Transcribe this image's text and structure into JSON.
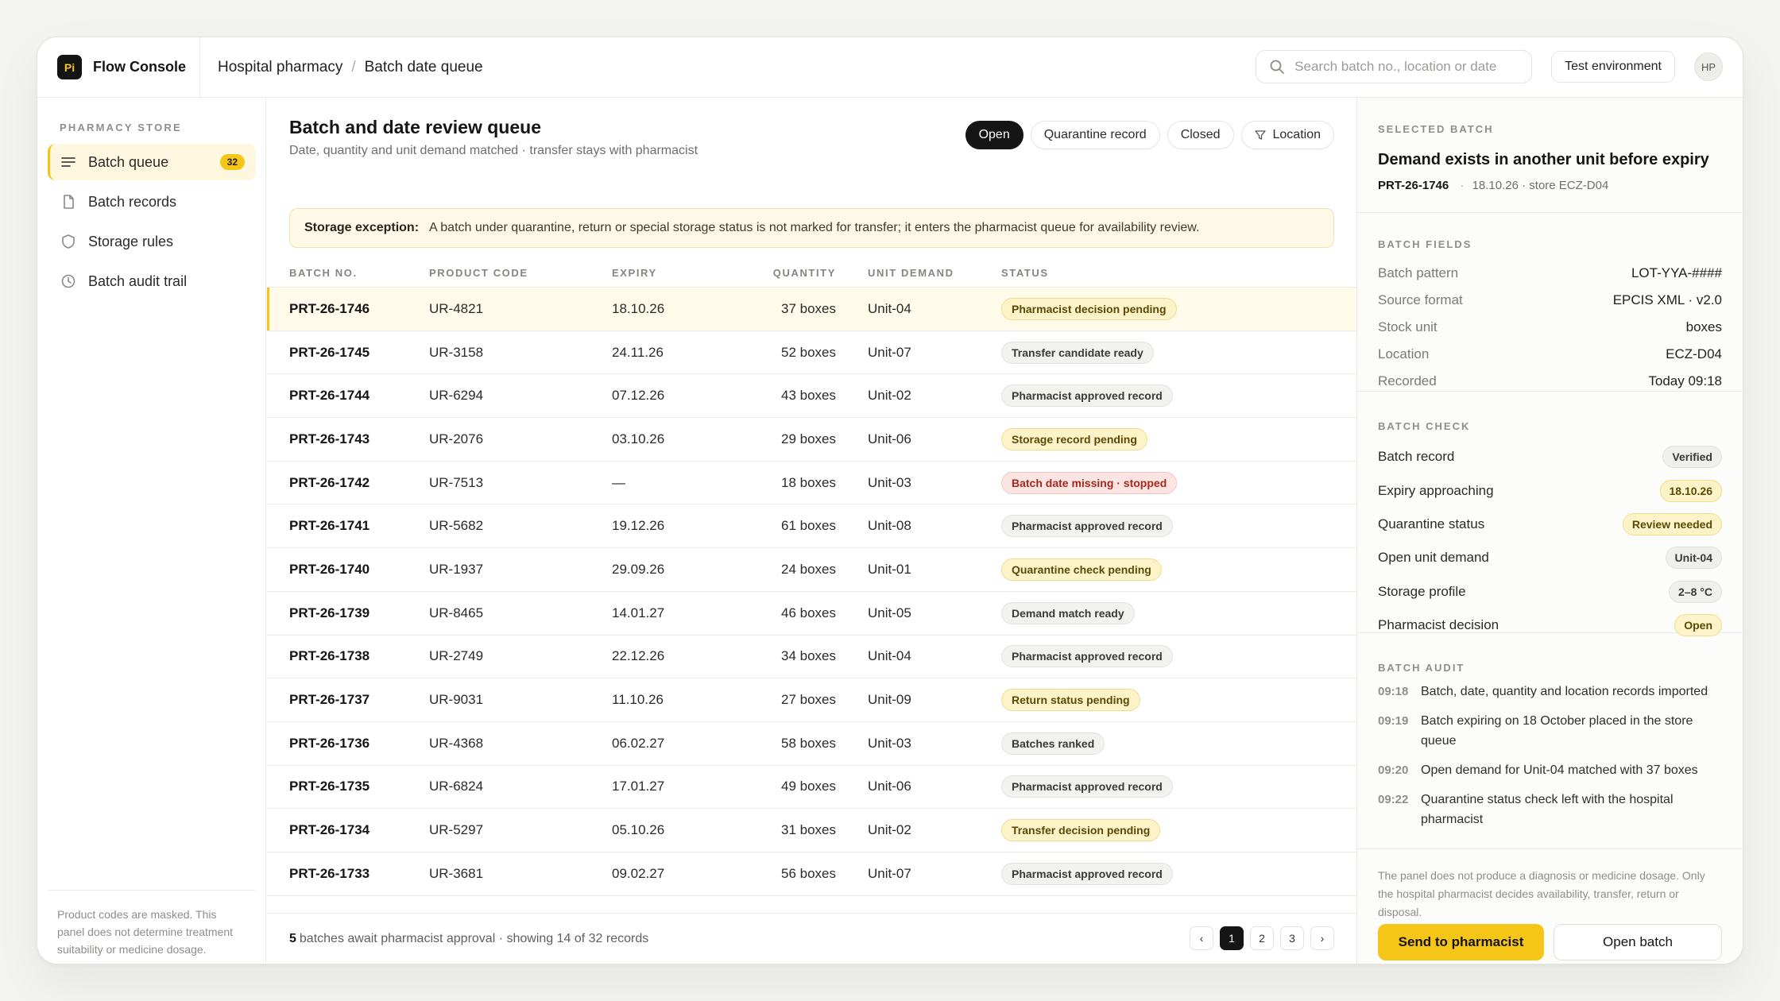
{
  "app": {
    "logo_text": "Pi",
    "name": "Flow Console"
  },
  "breadcrumb": {
    "section": "Hospital pharmacy",
    "separator": "/",
    "page": "Batch date queue"
  },
  "search": {
    "placeholder": "Search batch no., location or date",
    "icon": "search-icon"
  },
  "header": {
    "environment_label": "Test environment",
    "avatar_initials": "HP"
  },
  "sidebar": {
    "heading": "PHARMACY STORE",
    "items": [
      {
        "label": "Batch queue",
        "icon": "list-icon",
        "badge": "32",
        "active": true
      },
      {
        "label": "Batch records",
        "icon": "document-icon"
      },
      {
        "label": "Storage rules",
        "icon": "shield-icon"
      },
      {
        "label": "Batch audit trail",
        "icon": "clock-icon"
      }
    ],
    "footnote": "Product codes are masked. This panel does not determine treatment suitability or medicine dosage."
  },
  "main": {
    "title": "Batch and date review queue",
    "subtitle": "Date, quantity and unit demand matched · transfer stays with pharmacist",
    "filters": [
      {
        "label": "Open",
        "active": true
      },
      {
        "label": "Quarantine record"
      },
      {
        "label": "Closed"
      },
      {
        "label": "Location",
        "icon": "filter-icon"
      }
    ],
    "alert": {
      "title": "Storage exception:",
      "text": "A batch under quarantine, return or special storage status is not marked for transfer; it enters the pharmacist queue for availability review."
    },
    "table": {
      "columns": [
        "BATCH NO.",
        "PRODUCT CODE",
        "EXPIRY",
        "QUANTITY",
        "UNIT DEMAND",
        "STATUS"
      ],
      "rows": [
        {
          "batch": "PRT-26-1746",
          "code": "UR-4821",
          "expiry": "18.10.26",
          "qty": "37 boxes",
          "unit": "Unit-04",
          "status": "Pharmacist decision pending",
          "tone": "yellow",
          "selected": true
        },
        {
          "batch": "PRT-26-1745",
          "code": "UR-3158",
          "expiry": "24.11.26",
          "qty": "52 boxes",
          "unit": "Unit-07",
          "status": "Transfer candidate ready",
          "tone": "gray"
        },
        {
          "batch": "PRT-26-1744",
          "code": "UR-6294",
          "expiry": "07.12.26",
          "qty": "43 boxes",
          "unit": "Unit-02",
          "status": "Pharmacist approved record",
          "tone": "gray"
        },
        {
          "batch": "PRT-26-1743",
          "code": "UR-2076",
          "expiry": "03.10.26",
          "qty": "29 boxes",
          "unit": "Unit-06",
          "status": "Storage record pending",
          "tone": "yellow"
        },
        {
          "batch": "PRT-26-1742",
          "code": "UR-7513",
          "expiry": "—",
          "qty": "18 boxes",
          "unit": "Unit-03",
          "status": "Batch date missing · stopped",
          "tone": "red"
        },
        {
          "batch": "PRT-26-1741",
          "code": "UR-5682",
          "expiry": "19.12.26",
          "qty": "61 boxes",
          "unit": "Unit-08",
          "status": "Pharmacist approved record",
          "tone": "gray"
        },
        {
          "batch": "PRT-26-1740",
          "code": "UR-1937",
          "expiry": "29.09.26",
          "qty": "24 boxes",
          "unit": "Unit-01",
          "status": "Quarantine check pending",
          "tone": "yellow"
        },
        {
          "batch": "PRT-26-1739",
          "code": "UR-8465",
          "expiry": "14.01.27",
          "qty": "46 boxes",
          "unit": "Unit-05",
          "status": "Demand match ready",
          "tone": "gray"
        },
        {
          "batch": "PRT-26-1738",
          "code": "UR-2749",
          "expiry": "22.12.26",
          "qty": "34 boxes",
          "unit": "Unit-04",
          "status": "Pharmacist approved record",
          "tone": "gray"
        },
        {
          "batch": "PRT-26-1737",
          "code": "UR-9031",
          "expiry": "11.10.26",
          "qty": "27 boxes",
          "unit": "Unit-09",
          "status": "Return status pending",
          "tone": "yellow"
        },
        {
          "batch": "PRT-26-1736",
          "code": "UR-4368",
          "expiry": "06.02.27",
          "qty": "58 boxes",
          "unit": "Unit-03",
          "status": "Batches ranked",
          "tone": "gray"
        },
        {
          "batch": "PRT-26-1735",
          "code": "UR-6824",
          "expiry": "17.01.27",
          "qty": "49 boxes",
          "unit": "Unit-06",
          "status": "Pharmacist approved record",
          "tone": "gray"
        },
        {
          "batch": "PRT-26-1734",
          "code": "UR-5297",
          "expiry": "05.10.26",
          "qty": "31 boxes",
          "unit": "Unit-02",
          "status": "Transfer decision pending",
          "tone": "yellow"
        },
        {
          "batch": "PRT-26-1733",
          "code": "UR-3681",
          "expiry": "09.02.27",
          "qty": "56 boxes",
          "unit": "Unit-07",
          "status": "Pharmacist approved record",
          "tone": "gray"
        }
      ]
    },
    "footer": {
      "count": "5",
      "summary": "batches await pharmacist approval · showing 14 of 32 records"
    },
    "pagination": {
      "prev": "‹",
      "pages": [
        "1",
        "2",
        "3"
      ],
      "active_page": "1",
      "next": "›"
    }
  },
  "panel": {
    "selected_heading": "SELECTED BATCH",
    "title": "Demand exists in another unit before expiry",
    "batch": "PRT-26-1746",
    "meta_sep": "·",
    "meta": "18.10.26 · store ECZ-D04",
    "fields_heading": "BATCH FIELDS",
    "fields": [
      {
        "key": "Batch pattern",
        "value": "LOT-YYA-####"
      },
      {
        "key": "Source format",
        "value": "EPCIS XML · v2.0"
      },
      {
        "key": "Stock unit",
        "value": "boxes"
      },
      {
        "key": "Location",
        "value": "ECZ-D04"
      },
      {
        "key": "Recorded",
        "value": "Today 09:18"
      }
    ],
    "check_heading": "BATCH CHECK",
    "checks": [
      {
        "label": "Batch record",
        "tag": "Verified",
        "tone": "gray"
      },
      {
        "label": "Expiry approaching",
        "tag": "18.10.26",
        "tone": "yellow"
      },
      {
        "label": "Quarantine status",
        "tag": "Review needed",
        "tone": "yellow"
      },
      {
        "label": "Open unit demand",
        "tag": "Unit-04",
        "tone": "gray"
      },
      {
        "label": "Storage profile",
        "tag": "2–8 °C",
        "tone": "gray"
      },
      {
        "label": "Pharmacist decision",
        "tag": "Open",
        "tone": "yellow"
      }
    ],
    "audit_heading": "BATCH AUDIT",
    "audit": [
      {
        "time": "09:18",
        "text": "Batch, date, quantity and location records imported"
      },
      {
        "time": "09:19",
        "text": "Batch expiring on 18 October placed in the store queue"
      },
      {
        "time": "09:20",
        "text": "Open demand for Unit-04 matched with 37 boxes"
      },
      {
        "time": "09:22",
        "text": "Quarantine status check left with the hospital pharmacist"
      }
    ],
    "disclaimer": "The panel does not produce a diagnosis or medicine dosage. Only the hospital pharmacist decides availability, transfer, return or disposal.",
    "primary_action": "Send to pharmacist",
    "secondary_action": "Open batch"
  },
  "colors": {
    "accent": "#f5c518",
    "dark": "#151515",
    "pill_yellow": "#fdf3c9",
    "pill_red": "#fbe4e1",
    "pill_gray": "#f2f2ef"
  }
}
